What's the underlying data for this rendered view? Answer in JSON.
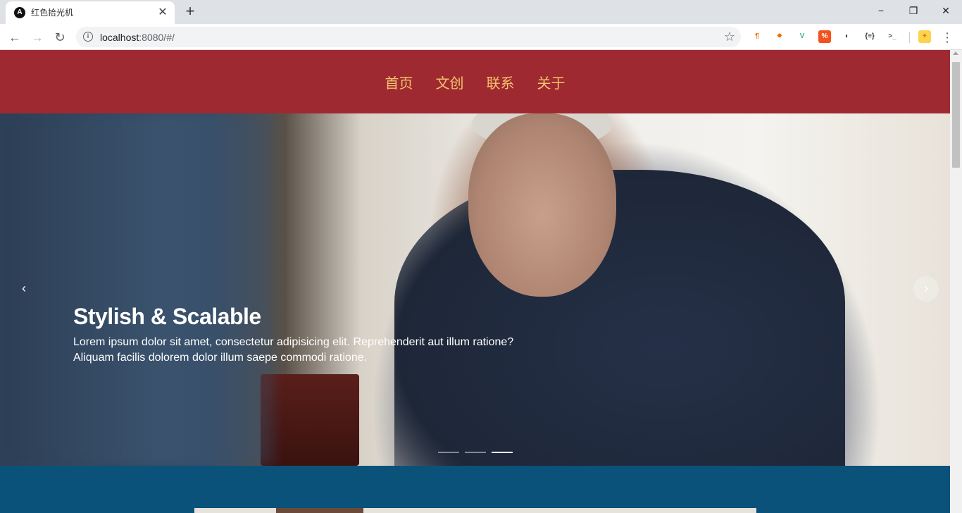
{
  "browser": {
    "tab": {
      "title": "红色拾光机",
      "favicon": "A"
    },
    "address": {
      "host": "localhost",
      "rest": ":8080/#/"
    },
    "window_controls": {
      "minimize": "−",
      "maximize": "❐",
      "close": "✕"
    },
    "extensions": [
      {
        "name": "pilcrow-extension-icon",
        "glyph": "¶",
        "color": "#e8710a"
      },
      {
        "name": "network-extension-icon",
        "glyph": "✸",
        "color": "#e8710a"
      },
      {
        "name": "vue-devtools-icon",
        "glyph": "V",
        "color": "#41b883"
      },
      {
        "name": "percent-extension-icon",
        "glyph": "%",
        "color": "#ffffff",
        "bg": "#f4511e"
      },
      {
        "name": "dark-circle-extension-icon",
        "glyph": "◐",
        "color": "#333333"
      },
      {
        "name": "json-extension-icon",
        "glyph": "{≡}",
        "color": "#333333"
      },
      {
        "name": "terminal-extension-icon",
        "glyph": ">_",
        "color": "#555555"
      },
      {
        "name": "profile-avatar-icon",
        "glyph": "✦",
        "color": "#e8710a",
        "bg": "#fcd34d"
      }
    ]
  },
  "site": {
    "nav": [
      "首页",
      "文创",
      "联系",
      "关于"
    ],
    "colors": {
      "header_bg": "#9f2931",
      "nav_text": "#f2c46d",
      "section_bg": "#0b527a"
    }
  },
  "carousel": {
    "title": "Stylish & Scalable",
    "line1": "Lorem ipsum dolor sit amet, consectetur adipisicing elit. Reprehenderit aut illum ratione?",
    "line2": "Aliquam facilis dolorem dolor illum saepe commodi ratione.",
    "prev_glyph": "‹",
    "next_glyph": "›",
    "slide_count": 3,
    "active_slide": 3
  }
}
